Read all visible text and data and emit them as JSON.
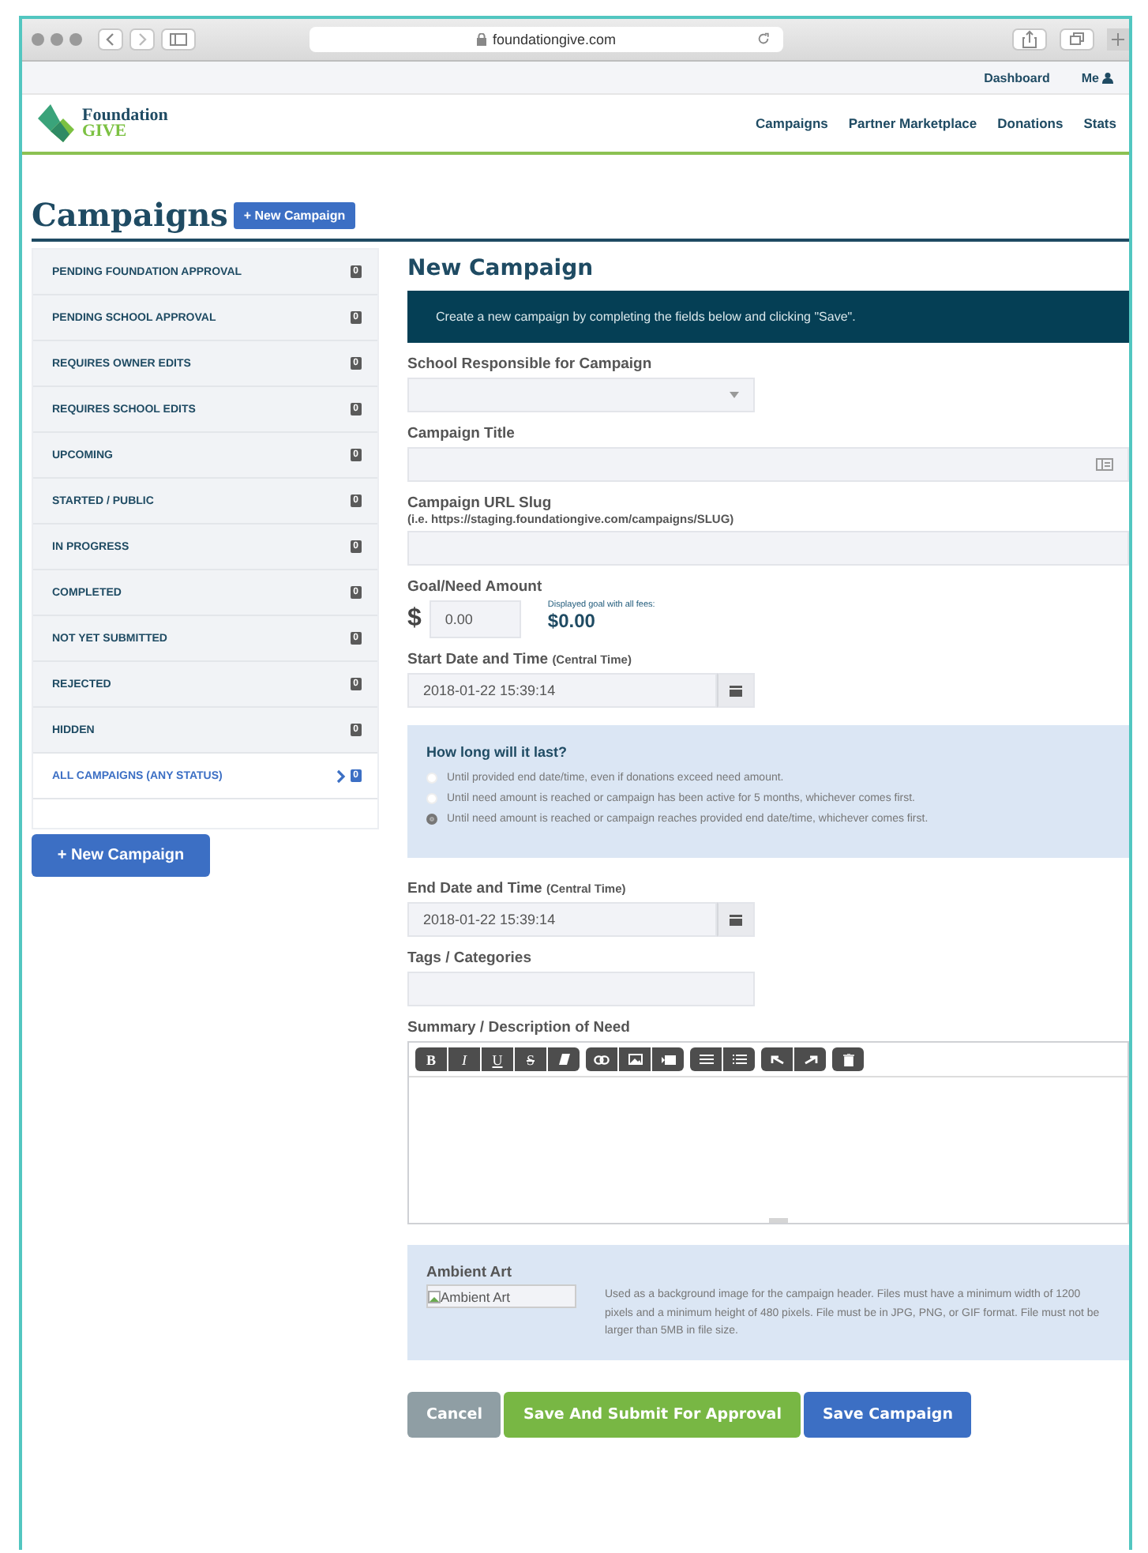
{
  "browser": {
    "url": "foundationgive.com"
  },
  "utility_nav": [
    {
      "label": "Dashboard"
    },
    {
      "label": "Me"
    }
  ],
  "logo": {
    "line1": "Foundation",
    "line2": "GIVE"
  },
  "main_nav": [
    "Campaigns",
    "Partner Marketplace",
    "Donations",
    "Stats"
  ],
  "page_title": "Campaigns",
  "header_button": "+ New Campaign",
  "sidebar": {
    "items": [
      {
        "label": "PENDING FOUNDATION APPROVAL",
        "count": "0",
        "selected": false
      },
      {
        "label": "PENDING SCHOOL APPROVAL",
        "count": "0",
        "selected": false
      },
      {
        "label": "REQUIRES OWNER EDITS",
        "count": "0",
        "selected": false
      },
      {
        "label": "REQUIRES SCHOOL EDITS",
        "count": "0",
        "selected": false
      },
      {
        "label": "UPCOMING",
        "count": "0",
        "selected": false
      },
      {
        "label": "STARTED / PUBLIC",
        "count": "0",
        "selected": false
      },
      {
        "label": "IN PROGRESS",
        "count": "0",
        "selected": false
      },
      {
        "label": "COMPLETED",
        "count": "0",
        "selected": false
      },
      {
        "label": "NOT YET SUBMITTED",
        "count": "0",
        "selected": false
      },
      {
        "label": "REJECTED",
        "count": "0",
        "selected": false
      },
      {
        "label": "HIDDEN",
        "count": "0",
        "selected": false
      },
      {
        "label": "ALL CAMPAIGNS (ANY STATUS)",
        "count": "0",
        "selected": true
      }
    ],
    "button": "+ New Campaign"
  },
  "form": {
    "heading": "New Campaign",
    "intro": "Create a new campaign by completing the fields below and clicking \"Save\".",
    "school_label": "School Responsible for Campaign",
    "title_label": "Campaign Title",
    "slug_label": "Campaign URL Slug",
    "slug_hint": "(i.e. https://staging.foundationgive.com/campaigns/SLUG)",
    "goal_label": "Goal/Need Amount",
    "currency": "$",
    "amount": "0.00",
    "fee_note": "Displayed goal with all fees:",
    "fee_total": "$0.00",
    "start_label": "Start Date and Time",
    "start_note": "(Central Time)",
    "start_value": "2018-01-22 15:39:14",
    "duration": {
      "title": "How long will it last?",
      "options": [
        {
          "label": "Until provided end date/time, even if donations exceed need amount.",
          "selected": false
        },
        {
          "label": "Until need amount is reached or campaign has been active for 5 months, whichever comes first.",
          "selected": false
        },
        {
          "label": "Until need amount is reached or campaign reaches provided end date/time, whichever comes first.",
          "selected": true
        }
      ]
    },
    "end_label": "End Date and Time",
    "end_note": "(Central Time)",
    "end_value": "2018-01-22 15:39:14",
    "tags_label": "Tags / Categories",
    "summary_label": "Summary / Description of Need",
    "toolbar_letters": [
      {
        "label": "B",
        "kind": "bold"
      },
      {
        "label": "I",
        "kind": "italic"
      },
      {
        "label": "U",
        "kind": "underline"
      },
      {
        "label": "S",
        "kind": "strike"
      }
    ],
    "ambient": {
      "title": "Ambient Art",
      "alt": "Ambient Art",
      "help": "Used as a background image for the campaign header. Files must have a minimum width of 1200 pixels and a minimum height of 480 pixels. File must be in JPG, PNG, or GIF format. File must not be larger than 5MB in file size."
    },
    "buttons": [
      {
        "label": "Cancel",
        "kind": "cancel"
      },
      {
        "label": "Save And Submit For Approval",
        "kind": "submit"
      },
      {
        "label": "Save Campaign",
        "kind": "save"
      }
    ]
  }
}
